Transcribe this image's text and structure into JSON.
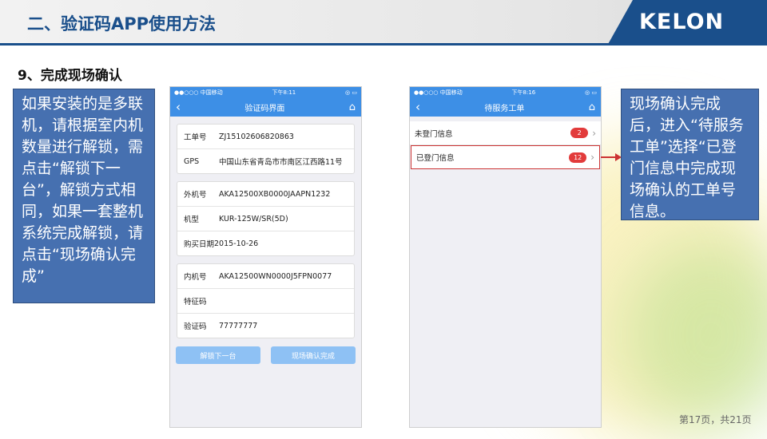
{
  "header": {
    "title": "二、验证码APP使用方法",
    "logo": "KELON",
    "brand_color": "#1a4f8b"
  },
  "section_title": "9、完成现场确认",
  "callout_left": {
    "text": "如果安装的是多联机，请根据室内机数量进行解锁，需点击“解锁下一台”，解锁方式相同，如果一套整机系统完成解锁，请点击“现场确认完成”"
  },
  "callout_right": {
    "text": "现场确认完成后，进入“待服务工单”选择“已登门信息中完成现场确认的工单号信息。"
  },
  "phone1": {
    "status": {
      "carrier": "●●○○○ 中国移动",
      "time": "下午8:11",
      "battery": "◎ ▭"
    },
    "nav": {
      "back": "‹",
      "title": "验证码界面",
      "home": "⌂"
    },
    "groups": [
      [
        {
          "label": "工单号",
          "value": "ZJ15102606820863"
        },
        {
          "label": "GPS",
          "value": "中国山东省青岛市市南区江西路11号"
        }
      ],
      [
        {
          "label": "外机号",
          "value": "AKA12500XB0000JAAPN1232"
        },
        {
          "label": "机型",
          "value": "KUR-125W/SR(5D)"
        },
        {
          "label": "购买日期",
          "value": "2015-10-26"
        }
      ],
      [
        {
          "label": "内机号",
          "value": "AKA12500WN0000J5FPN0077"
        },
        {
          "label": "特征码",
          "value": ""
        },
        {
          "label": "验证码",
          "value": "77777777"
        }
      ]
    ],
    "buttons": {
      "unlock_next": "解锁下一台",
      "confirm_done": "现场确认完成"
    }
  },
  "phone2": {
    "status": {
      "carrier": "●●○○○ 中国移动",
      "time": "下午8:16",
      "battery": "◎ ▭"
    },
    "nav": {
      "back": "‹",
      "title": "待服务工单",
      "home": "⌂"
    },
    "items": [
      {
        "label": "未登门信息",
        "count": "2"
      },
      {
        "label": "已登门信息",
        "count": "12"
      }
    ]
  },
  "page_number": "第17页，共21页"
}
